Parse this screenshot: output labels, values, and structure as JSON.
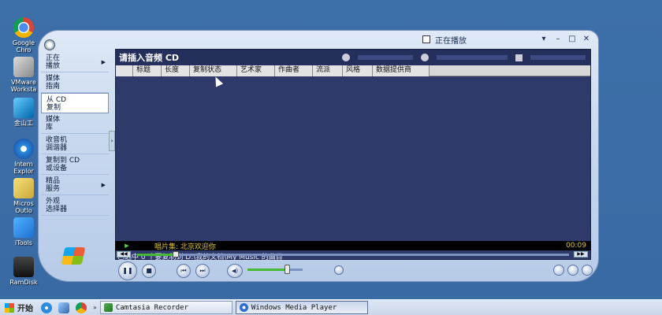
{
  "desktop": {
    "icons": [
      {
        "name": "Google Chrome",
        "label": "Google\nChro",
        "icon": "chrome-icon"
      },
      {
        "name": "VMware Workstation",
        "label": "VMware\nWorksta",
        "icon": "vmware-icon"
      },
      {
        "name": "Kingsoft",
        "label": "金山工",
        "icon": "kingsoft-icon"
      },
      {
        "name": "Internet Explorer",
        "label": "Intern\nExplor",
        "icon": "ie-icon"
      },
      {
        "name": "Microsoft Outlook",
        "label": "Micros\nOutlo",
        "icon": "outlook-icon"
      },
      {
        "name": "iTools",
        "label": "iTools",
        "icon": "itools-icon"
      },
      {
        "name": "RamDisk",
        "label": "RamDisk",
        "icon": "ramdisk-icon"
      }
    ]
  },
  "wmp": {
    "title": "正在播放",
    "window_controls": {
      "menu": "▾",
      "minimize": "–",
      "maximize": "□",
      "close": "✕"
    },
    "taskpane": [
      {
        "label": "正在\n播放",
        "arrow": "▶"
      },
      {
        "label": "媒体\n指南",
        "arrow": ""
      },
      {
        "label": "从 CD\n复制",
        "arrow": ""
      },
      {
        "label": "媒体\n库",
        "arrow": ""
      },
      {
        "label": "收音机\n调谐器",
        "arrow": ""
      },
      {
        "label": "复制到 CD\n或设备",
        "arrow": ""
      },
      {
        "label": "精品\n服务",
        "arrow": "▶"
      },
      {
        "label": "外观\n选择器",
        "arrow": ""
      }
    ],
    "header": {
      "title": "请插入音频 CD"
    },
    "columns": [
      "标题",
      "长度",
      "复制状态",
      "艺术家",
      "作曲者",
      "流派",
      "风格",
      "数据提供商"
    ],
    "status": "已选中 0 个要复制到 D:\\我的文档\\My Music 的曲目",
    "now_playing": {
      "play_glyph": "▶",
      "title": "唱片集: 北京欢迎你",
      "time": "00:09"
    },
    "seek": {
      "progress": 0.09
    },
    "volume": {
      "level": 0.72
    },
    "buttons": {
      "pause": "❚❚",
      "stop": "■",
      "prev": "⏮",
      "next": "⏭",
      "mute": "◀)"
    }
  },
  "taskbar": {
    "start_label": "开始",
    "separator": "»",
    "tasks": [
      {
        "label": "Camtasia Recorder",
        "active": false
      },
      {
        "label": "Windows Media Player",
        "active": true
      }
    ]
  }
}
